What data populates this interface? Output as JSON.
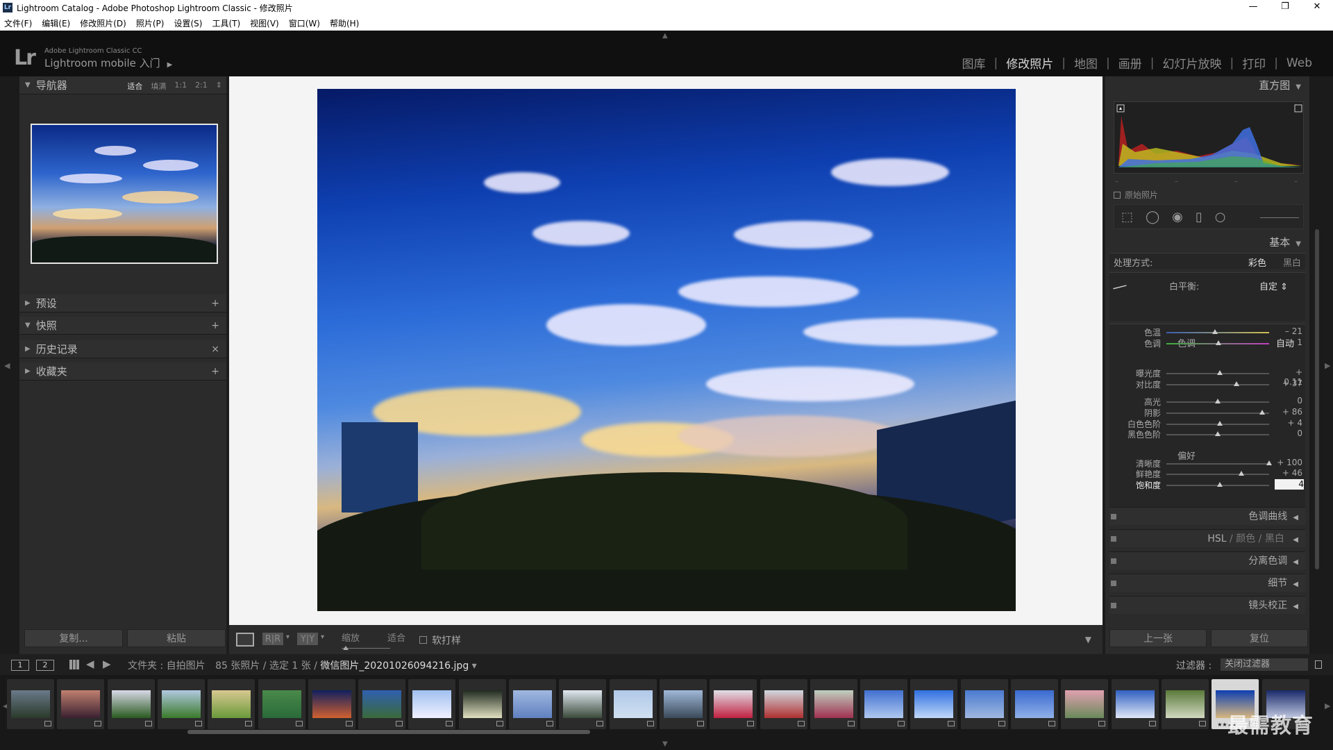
{
  "window": {
    "title": "Lightroom Catalog - Adobe Photoshop Lightroom Classic - 修改照片",
    "app_icon": "Lr",
    "controls": [
      "—",
      "❐",
      "✕"
    ]
  },
  "menu": [
    "文件(F)",
    "编辑(E)",
    "修改照片(D)",
    "照片(P)",
    "设置(S)",
    "工具(T)",
    "视图(V)",
    "窗口(W)",
    "帮助(H)"
  ],
  "identity": {
    "logo": "Lr",
    "line1": "Adobe Lightroom Classic CC",
    "line2": "Lightroom mobile 入门",
    "arrow": "▶"
  },
  "modules": {
    "items": [
      "图库",
      "修改照片",
      "地图",
      "画册",
      "幻灯片放映",
      "打印",
      "Web"
    ],
    "active": "修改照片"
  },
  "left": {
    "navigator": {
      "title": "导航器",
      "options": [
        "适合",
        "填满",
        "1:1",
        "2:1"
      ],
      "active_option": "适合",
      "stepper": "⇕"
    },
    "sections": [
      {
        "title": "预设",
        "action": "+"
      },
      {
        "title": "快照",
        "action": "+"
      },
      {
        "title": "历史记录",
        "action": "×"
      },
      {
        "title": "收藏夹",
        "action": "+"
      }
    ],
    "buttons": {
      "copy": "复制...",
      "paste": "粘贴"
    }
  },
  "toolbar": {
    "ry1": "R|R",
    "ry2": "Y|Y",
    "zoom_label": "缩放",
    "zoom_value": "适合",
    "softproof": "软打样",
    "drop": "▼"
  },
  "right": {
    "histogram": {
      "title": "直方图",
      "original": "原始照片",
      "marks": [
        "–",
        "–",
        "–",
        "–"
      ]
    },
    "tools": [
      "⬚",
      "◯",
      "◉",
      "▯",
      "○"
    ],
    "basic": {
      "title": "基本",
      "treatment_label": "处理方式:",
      "treatment_color": "彩色",
      "treatment_bw": "黑白",
      "wb_label": "白平衡:",
      "wb_value": "自定 ⇕",
      "tone_label": "色调",
      "tone_auto": "自动",
      "presence_label": "偏好",
      "sliders": [
        {
          "label": "色温",
          "value": "– 21",
          "pos": 0.47
        },
        {
          "label": "色调",
          "value": "+ 1",
          "pos": 0.51
        },
        {
          "label": "曝光度",
          "value": "+ 0.11",
          "pos": 0.52
        },
        {
          "label": "对比度",
          "value": "+ 37",
          "pos": 0.68
        },
        {
          "label": "高光",
          "value": "0",
          "pos": 0.5
        },
        {
          "label": "阴影",
          "value": "+ 86",
          "pos": 0.93
        },
        {
          "label": "白色色阶",
          "value": "+ 4",
          "pos": 0.52
        },
        {
          "label": "黑色色阶",
          "value": "0",
          "pos": 0.5
        },
        {
          "label": "清晰度",
          "value": "+ 100",
          "pos": 1.0
        },
        {
          "label": "鲜艳度",
          "value": "+ 46",
          "pos": 0.73
        },
        {
          "label": "饱和度",
          "value": "4",
          "pos": 0.52
        }
      ]
    },
    "sections": [
      {
        "title": "色调曲线"
      },
      {
        "title": "HSL",
        "extra1": "颜色",
        "extra2": "黑白"
      },
      {
        "title": "分离色调"
      },
      {
        "title": "细节"
      },
      {
        "title": "镜头校正"
      }
    ],
    "buttons": {
      "prev": "上一张",
      "reset": "复位"
    }
  },
  "filmstrip_bar": {
    "screen1": "1",
    "screen2": "2",
    "prev": "◀",
    "next": "▶",
    "path_prefix": "文件夹 : 自拍图片",
    "count": "85 张照片 / 选定 1 张 /",
    "filename": "微信图片_20201026094216.jpg",
    "filename_drop": "▾",
    "filter_label": "过滤器 :",
    "filter_value": "关闭过滤器"
  },
  "filmstrip": {
    "selected_stars": "★★★★",
    "thumbs": [
      {
        "colors": [
          "#6a7a8a",
          "#2a3a2a"
        ]
      },
      {
        "colors": [
          "#c08070",
          "#3a2030"
        ]
      },
      {
        "colors": [
          "#d8d8e8",
          "#2a5a20"
        ]
      },
      {
        "colors": [
          "#b0c8e0",
          "#3a7a2a"
        ]
      },
      {
        "colors": [
          "#d8c890",
          "#6a9a3a"
        ]
      },
      {
        "colors": [
          "#4a8a4a",
          "#2a6a3a"
        ]
      },
      {
        "colors": [
          "#102060",
          "#d06030"
        ]
      },
      {
        "colors": [
          "#3060b0",
          "#3a6a3a"
        ]
      },
      {
        "colors": [
          "#a0c0f0",
          "#f0f0ff"
        ]
      },
      {
        "colors": [
          "#202a20",
          "#e0e0c0"
        ]
      },
      {
        "colors": [
          "#a0b8e0",
          "#6080c0"
        ]
      },
      {
        "colors": [
          "#e0e8f0",
          "#3a4a3a"
        ]
      },
      {
        "colors": [
          "#b0c8e8",
          "#d0e0f0"
        ]
      },
      {
        "colors": [
          "#a0b8d8",
          "#3a4a5a"
        ]
      },
      {
        "colors": [
          "#e0e0e8",
          "#c02040"
        ]
      },
      {
        "colors": [
          "#d0d8e0",
          "#b03030"
        ]
      },
      {
        "colors": [
          "#c0d0c0",
          "#a03050"
        ]
      },
      {
        "colors": [
          "#4070d0",
          "#b0c8f0"
        ]
      },
      {
        "colors": [
          "#3070e0",
          "#c0d8f8"
        ]
      },
      {
        "colors": [
          "#4a7ad0",
          "#a0b8e0"
        ]
      },
      {
        "colors": [
          "#3a6ad0",
          "#90b0e8"
        ]
      },
      {
        "colors": [
          "#e0a0b0",
          "#6a8a5a"
        ]
      },
      {
        "colors": [
          "#3060c0",
          "#e0e8f8"
        ]
      },
      {
        "colors": [
          "#5a7a3a",
          "#d0d8c0"
        ]
      },
      {
        "colors": [
          "#0e3fb0",
          "#d8b880"
        ]
      },
      {
        "colors": [
          "#1a2a6a",
          "#c0c8e0"
        ]
      }
    ]
  },
  "watermark": "最需教育"
}
